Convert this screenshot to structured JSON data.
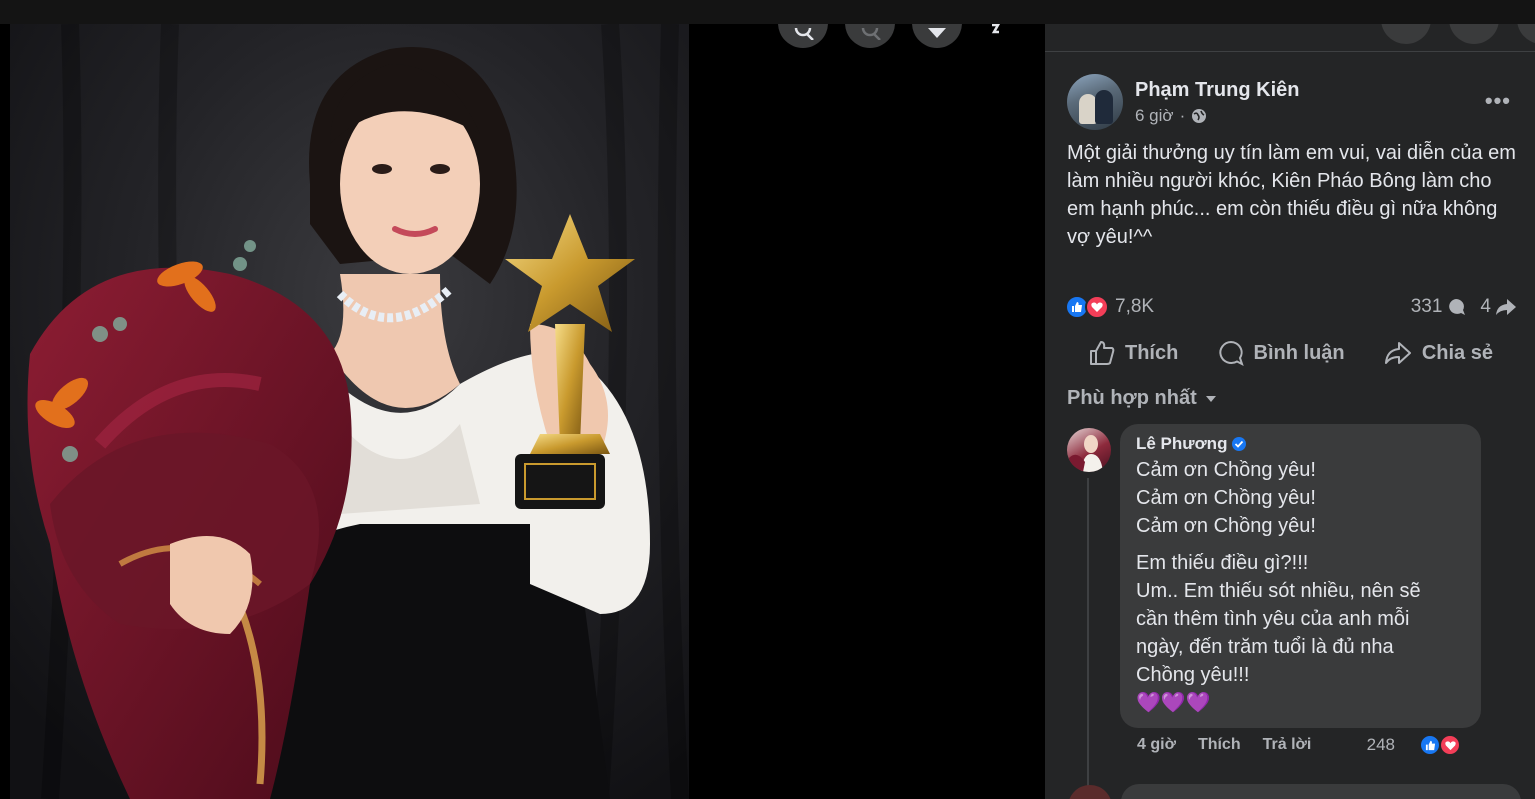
{
  "post": {
    "author": "Phạm Trung Kiên",
    "time": "6 giờ",
    "separator": "·",
    "more": "•••",
    "text": "Một giải thưởng uy tín làm em vui, vai diễn của em làm nhiều người khóc, Kiên Pháo Bông làm cho em hạnh phúc... em còn thiếu điều gì nữa không vợ yêu!^^",
    "reactions_count": "7,8K",
    "comments_count": "331",
    "shares_count": "4"
  },
  "actions": {
    "like": "Thích",
    "comment": "Bình luận",
    "share": "Chia sẻ"
  },
  "sort_label": "Phù hợp nhất",
  "comment": {
    "author": "Lê Phương",
    "lines": [
      "Cảm ơn Chồng yêu!",
      "Cảm ơn Chồng yêu!",
      "Cảm ơn Chồng yêu!",
      "Em thiếu điều gì?!!!",
      "Um.. Em thiếu sót nhiều, nên sẽ",
      "cần thêm tình yêu của anh mỗi",
      "ngày, đến trăm tuổi là đủ nha",
      "Chồng yêu!!!",
      "💜💜💜"
    ],
    "time": "4 giờ",
    "like": "Thích",
    "reply": "Trả lời",
    "reactions_count": "248"
  },
  "icons": {
    "viewer_buttons": [
      "zoom-in-icon",
      "zoom-out-icon",
      "tag-icon",
      "fullscreen-icon"
    ],
    "like_color": "#1877f2",
    "love_color": "#f33e58"
  }
}
